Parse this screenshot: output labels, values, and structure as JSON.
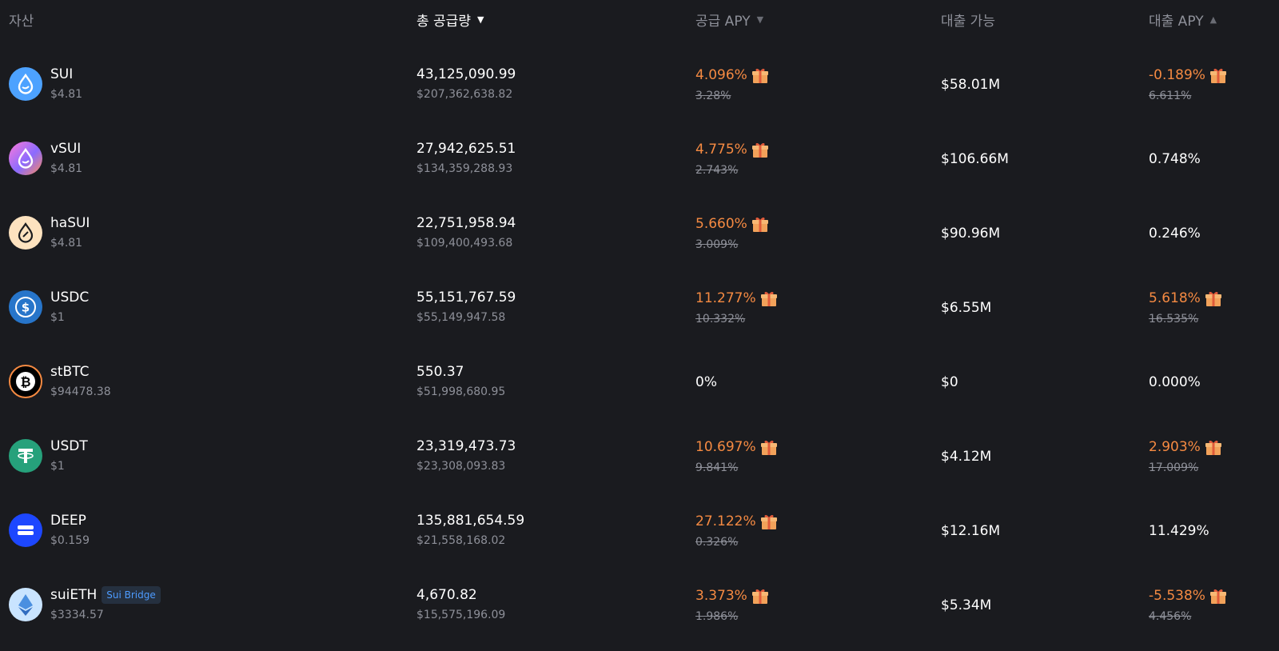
{
  "header": {
    "asset": "자산",
    "total_supply": "총 공급량",
    "supply_apy": "공급 APY",
    "borrowable": "대출 가능",
    "borrow_apy": "대출 APY",
    "sort_down": "▼",
    "sort_up": "▲"
  },
  "colors": {
    "background": "#1a1b1f",
    "accent_orange": "#f58a42",
    "muted": "#8e9099",
    "badge_text": "#4d9bff"
  },
  "rows": [
    {
      "symbol": "SUI",
      "price": "$4.81",
      "icon": "sui-drop-icon",
      "supply": "43,125,090.99",
      "supply_usd": "$207,362,638.82",
      "supply_apy": "4.096%",
      "supply_apy_base": "3.28%",
      "borrowable": "$58.01M",
      "borrow_apy": "-0.189%",
      "borrow_apy_base": "6.611%"
    },
    {
      "symbol": "vSUI",
      "price": "$4.81",
      "icon": "vsui-drop-icon",
      "supply": "27,942,625.51",
      "supply_usd": "$134,359,288.93",
      "supply_apy": "4.775%",
      "supply_apy_base": "2.743%",
      "borrowable": "$106.66M",
      "borrow_apy": "0.748%"
    },
    {
      "symbol": "haSUI",
      "price": "$4.81",
      "icon": "hasui-drop-icon",
      "supply": "22,751,958.94",
      "supply_usd": "$109,400,493.68",
      "supply_apy": "5.660%",
      "supply_apy_base": "3.009%",
      "borrowable": "$90.96M",
      "borrow_apy": "0.246%"
    },
    {
      "symbol": "USDC",
      "price": "$1",
      "icon": "usdc-icon",
      "supply": "55,151,767.59",
      "supply_usd": "$55,149,947.58",
      "supply_apy": "11.277%",
      "supply_apy_base": "10.332%",
      "borrowable": "$6.55M",
      "borrow_apy": "5.618%",
      "borrow_apy_base": "16.535%"
    },
    {
      "symbol": "stBTC",
      "price": "$94478.38",
      "icon": "bitcoin-icon",
      "supply": "550.37",
      "supply_usd": "$51,998,680.95",
      "supply_apy": "0%",
      "borrowable": "$0",
      "borrow_apy": "0.000%"
    },
    {
      "symbol": "USDT",
      "price": "$1",
      "icon": "tether-icon",
      "supply": "23,319,473.73",
      "supply_usd": "$23,308,093.83",
      "supply_apy": "10.697%",
      "supply_apy_base": "9.841%",
      "borrowable": "$4.12M",
      "borrow_apy": "2.903%",
      "borrow_apy_base": "17.009%"
    },
    {
      "symbol": "DEEP",
      "price": "$0.159",
      "icon": "deep-icon",
      "supply": "135,881,654.59",
      "supply_usd": "$21,558,168.02",
      "supply_apy": "27.122%",
      "supply_apy_base": "0.326%",
      "borrowable": "$12.16M",
      "borrow_apy": "11.429%"
    },
    {
      "symbol": "suiETH",
      "badge": "Sui Bridge",
      "price": "$3334.57",
      "icon": "ethereum-icon",
      "supply": "4,670.82",
      "supply_usd": "$15,575,196.09",
      "supply_apy": "3.373%",
      "supply_apy_base": "1.986%",
      "borrowable": "$5.34M",
      "borrow_apy": "-5.538%",
      "borrow_apy_base": "4.456%"
    }
  ]
}
